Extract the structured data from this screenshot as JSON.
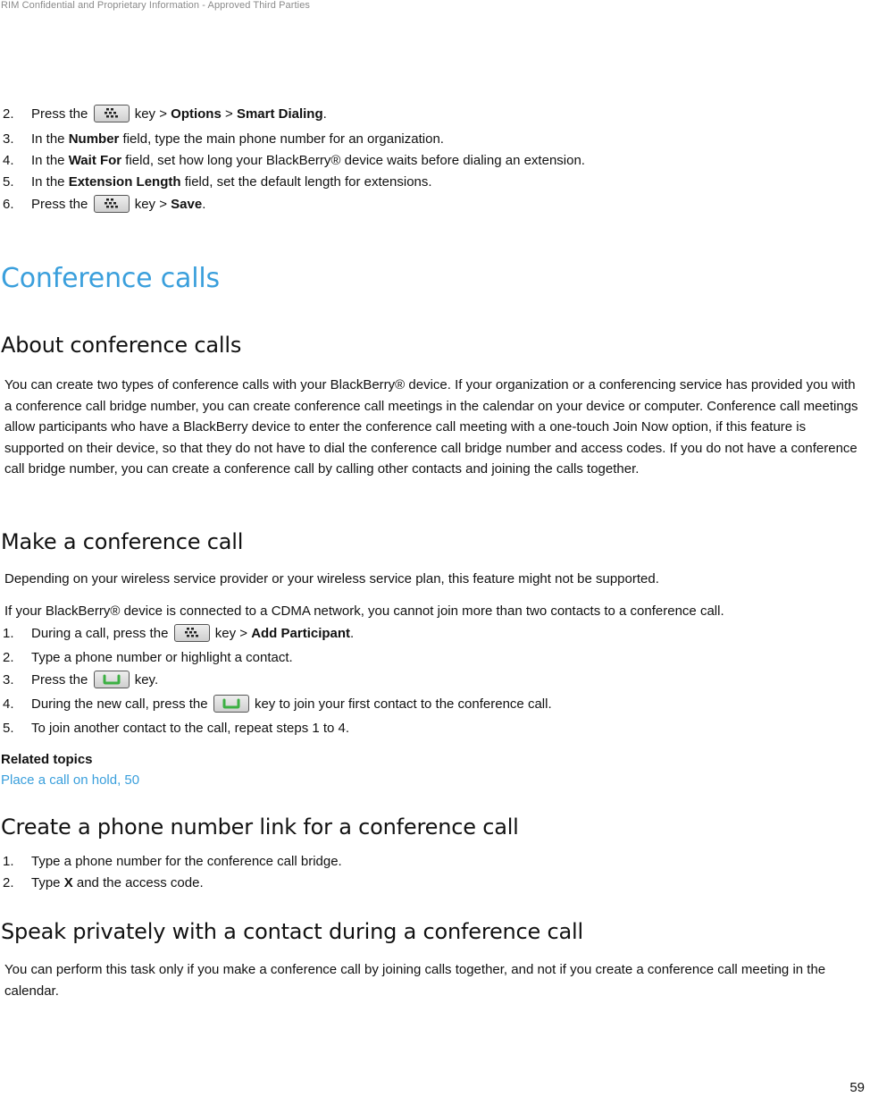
{
  "header": {
    "confidential": "RIM Confidential and Proprietary Information - Approved Third Parties"
  },
  "footer": {
    "page_number": "59"
  },
  "smart_dialing_steps": [
    {
      "num": "2.",
      "pre": "Press the",
      "key": "menu-key",
      "post": " key > ",
      "b1": "Options",
      "mid": " > ",
      "b2": "Smart Dialing",
      "end": "."
    },
    {
      "num": "3.",
      "pre": "In the ",
      "b1": "Number",
      "post": " field, type the main phone number for an organization."
    },
    {
      "num": "4.",
      "pre": "In the ",
      "b1": "Wait For",
      "post": " field, set how long your BlackBerry® device waits before dialing an extension."
    },
    {
      "num": "5.",
      "pre": "In the ",
      "b1": "Extension Length",
      "post": " field, set the default length for extensions."
    },
    {
      "num": "6.",
      "pre": "Press the",
      "key": "menu-key",
      "post": " key > ",
      "b1": "Save",
      "end": "."
    }
  ],
  "section_title": "Conference calls",
  "about": {
    "title": "About conference calls",
    "body": "You can create two types of conference calls with your BlackBerry® device. If your organization or a conferencing service has provided you with a conference call bridge number, you can create conference call meetings in the calendar on your device or computer. Conference call meetings allow participants who have a BlackBerry device to enter the conference call meeting with a one-touch Join Now option, if this feature is supported on their device, so that they do not have to dial the conference call bridge number and access codes. If you do not have a conference call bridge number, you can create a conference call by calling other contacts and joining the calls together."
  },
  "make_call": {
    "title": "Make a conference call",
    "note1": "Depending on your wireless service provider or your wireless service plan, this feature might not be supported.",
    "note2": "If your BlackBerry® device is connected to a CDMA network, you cannot join more than two contacts to a conference call.",
    "steps": [
      {
        "num": "1.",
        "pre": "During a call, press the",
        "key": "menu-key",
        "post": " key > ",
        "b1": "Add Participant",
        "end": "."
      },
      {
        "num": "2.",
        "pre": "Type a phone number or highlight a contact."
      },
      {
        "num": "3.",
        "pre": "Press the",
        "key": "send-key",
        "post": " key."
      },
      {
        "num": "4.",
        "pre": "During the new call, press the",
        "key": "send-key",
        "post": " key to join your first contact to the conference call."
      },
      {
        "num": "5.",
        "pre": "To join another contact to the call, repeat steps 1 to 4."
      }
    ],
    "related_title": "Related topics",
    "related_link": "Place a call on hold, 50"
  },
  "phone_link": {
    "title": "Create a phone number link for a conference call",
    "steps": [
      {
        "num": "1.",
        "pre": "Type a phone number for the conference call bridge."
      },
      {
        "num": "2.",
        "pre": "Type ",
        "b1": "X",
        "post": " and the access code."
      }
    ]
  },
  "speak_privately": {
    "title": "Speak privately with a contact during a conference call",
    "body": "You can perform this task only if you make a conference call by joining calls together, and not if you create a conference call meeting in the calendar."
  },
  "colors": {
    "heading_blue": "#3a9fdc",
    "send_key_green": "#3cb043"
  }
}
